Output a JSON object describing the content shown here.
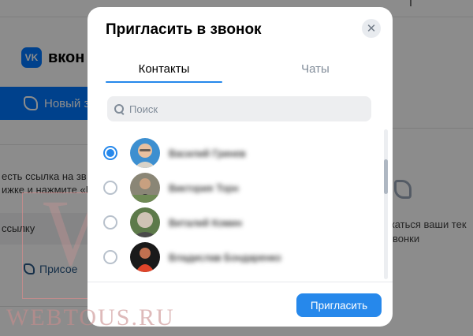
{
  "background": {
    "brand": "вкон",
    "new_call_label": "Новый з",
    "link_text_line1": "есть ссылка на зв",
    "link_text_line2": "ижке и нажмите «П",
    "link_box_text": "ссылку",
    "join_label": "Присое",
    "right_text_line1": "жаться ваши тек",
    "right_text_line2": "звонки"
  },
  "watermark": {
    "letter": "W",
    "text": "WEBTOUS.RU"
  },
  "modal": {
    "title": "Пригласить в звонок",
    "close_icon": "close-icon",
    "tabs": [
      {
        "label": "Контакты",
        "active": true
      },
      {
        "label": "Чаты",
        "active": false
      }
    ],
    "search": {
      "placeholder": "Поиск",
      "value": ""
    },
    "contacts": [
      {
        "name": "Василий Гринев",
        "selected": true
      },
      {
        "name": "Виктория Торн",
        "selected": false
      },
      {
        "name": "Виталий Комин",
        "selected": false
      },
      {
        "name": "Владислав Бондаренко",
        "selected": false
      }
    ],
    "invite_label": "Пригласить"
  },
  "colors": {
    "accent": "#2688eb",
    "vk_blue": "#0077ff",
    "overlay": "rgba(0,0,0,0.45)"
  }
}
